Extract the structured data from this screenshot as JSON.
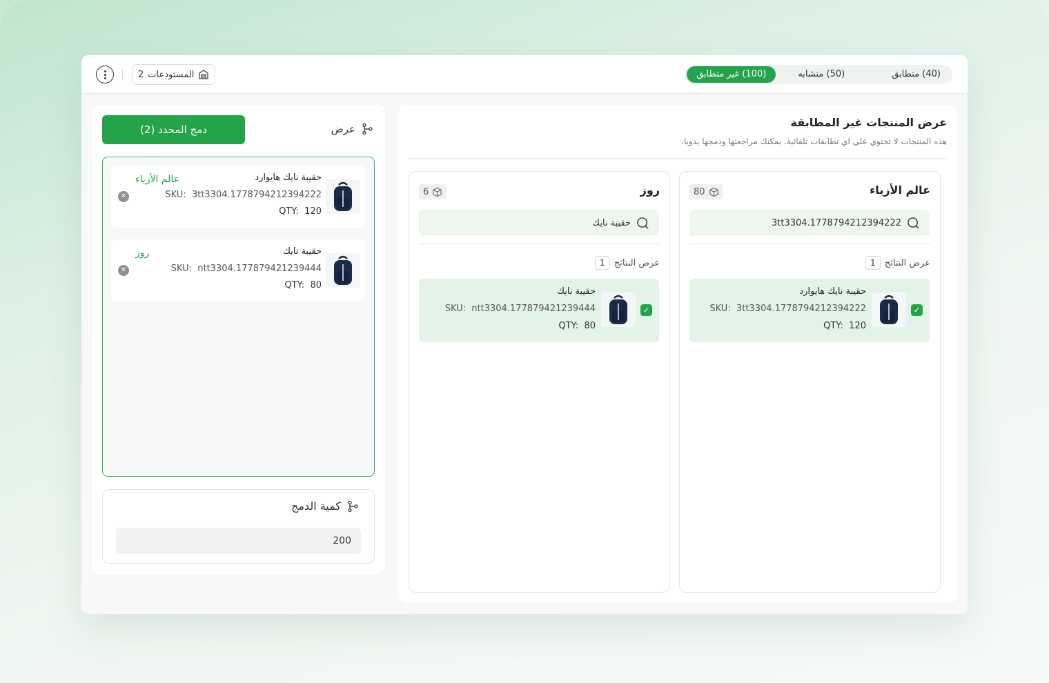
{
  "tabs": [
    {
      "label": "(40) متطابق",
      "active": false
    },
    {
      "label": "(50) متشابه",
      "active": false
    },
    {
      "label": "(100) غير متطابق",
      "active": true
    }
  ],
  "warehouses": {
    "label": "المستودعات",
    "count": "2",
    "icon": "warehouse-icon"
  },
  "left_panel": {
    "merge_button": "دمج المحدد (2)",
    "view_label": "عرض",
    "selected_items": [
      {
        "name": "حقيبة نايك هايوارد",
        "sku_label": "SKU:",
        "sku": "3tt3304.1778794212394222",
        "qty_label": "QTY:",
        "qty": "120",
        "store": "عالم الأزياء"
      },
      {
        "name": "حقيبة نايك",
        "sku_label": "SKU:",
        "sku": "ntt3304.177879421239444",
        "qty_label": "QTY:",
        "qty": "80",
        "store": "روز"
      }
    ],
    "merge_qty": {
      "title": "كمية الدمج",
      "value": "200"
    }
  },
  "main": {
    "title": "عرض المنتجات غير المطابقة",
    "subtitle": "هذه المنتجات لا تحتوي على اي تطابقات تلقائية. يمكنك مراجعتها ودمجها يدويا.",
    "columns": [
      {
        "store": "عالم الأزياء",
        "count": "80",
        "search_value": "3tt3304.1778794212394222",
        "results_label": "عرض النتائج",
        "results_count": "1",
        "product": {
          "name": "حقيبة نايك هايوارد",
          "sku_label": "SKU:",
          "sku": "3tt3304.1778794212394222",
          "qty_label": "QTY:",
          "qty": "120",
          "checked": true
        }
      },
      {
        "store": "روز",
        "count": "6",
        "search_value": "حقيبة نايك",
        "results_label": "عرض النتائج",
        "results_count": "1",
        "product": {
          "name": "حقيبة نايك",
          "sku_label": "SKU:",
          "sku": "ntt3304.177879421239444",
          "qty_label": "QTY:",
          "qty": "80",
          "checked": true
        }
      }
    ]
  },
  "colors": {
    "accent": "#23a44b",
    "accent_light": "#e4f3e8",
    "border_green": "#3cae62"
  }
}
